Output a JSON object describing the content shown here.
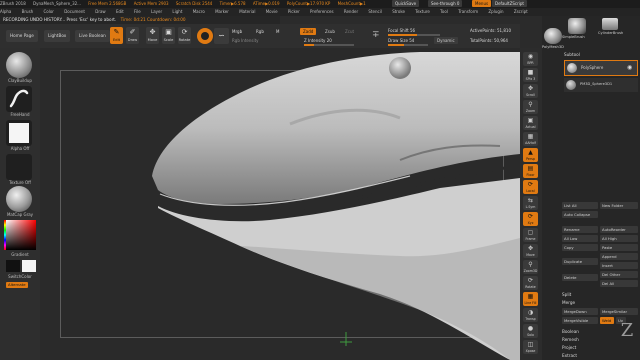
{
  "titlebar": {
    "app": "ZBrush 2018",
    "doc": "DynaMesh_Sphere_32...",
    "free_mem": "Free Mem 2.568GB",
    "active_mem": "Active Mem 2903",
    "scratch": "Scratch Disk 2544",
    "timer": "Timer▶6.578",
    "atime": "ATime▶0.019",
    "polycount": "PolyCount▶17.970 KP",
    "meshcount": "MeshCount▶1",
    "quicksave": "QuickSave",
    "seethrough": "See-through 0",
    "menus": "Menus",
    "default_script": "DefaultZScript"
  },
  "menubar": {
    "items": [
      "Alpha",
      "Brush",
      "Color",
      "Document",
      "Draw",
      "Edit",
      "File",
      "Layer",
      "Light",
      "Macro",
      "Marker",
      "Material",
      "Movie",
      "Picker",
      "Preferences",
      "Render",
      "Stencil",
      "Stroke",
      "Texture",
      "Tool",
      "Transform",
      "Zplugin",
      "Zscript"
    ]
  },
  "notice": {
    "text": "RECORDING UNDO HISTORY... Press 'Esc' key to abort.",
    "timer": "Time: 0d:21 Countdown: 0d:00"
  },
  "toolbar": {
    "home_page": "Home Page",
    "lightbox": "LightBox",
    "live_boolean": "Live Boolean",
    "edit": "Edit",
    "draw": "Draw",
    "move": "Move",
    "scale": "Scale",
    "rotate": "Rotate",
    "mrgb": "Mrgb",
    "rgb": "Rgb",
    "m": "M",
    "rgb_intensity": "Rgb Intensity",
    "zadd": "Zadd",
    "zsub": "Zsub",
    "zcut": "Zcut",
    "z_intensity": "Z Intensity 20",
    "focal_shift": "Focal Shift 56",
    "draw_size": "Draw Size 54",
    "dynamic": "Dynamic",
    "active_points": "ActivePoints: 51,810",
    "total_points": "TotalPoints: 50,964",
    "focal_shift_level": 0.55,
    "draw_size_level": 0.4,
    "z_intensity_level": 0.2
  },
  "leftshelf": {
    "brush": "ClayBuildup",
    "stroke": "FreeHand",
    "alpha": "Alpha Off",
    "texture": "Texture Off",
    "material": "MatCap Gray",
    "gradient": "Gradient",
    "switch_color": "SwitchColor",
    "alternate": "Alternate"
  },
  "rightstrip": {
    "items": [
      "BPR",
      "SPix 3",
      "Scroll",
      "Zoom",
      "Actual",
      "AAHalf",
      "Persp",
      "Floor",
      "Local",
      "L.Sym",
      "Xyz",
      "Frame",
      "Move",
      "Zoom3D",
      "Rotate",
      "Line Fill",
      "Transp",
      "Solo",
      "Xpose"
    ]
  },
  "tray": {
    "top_buttons": [
      "SimpleBrush",
      "PolyMesh3D",
      "CylinderBrush"
    ],
    "subtool_title": "Subtool",
    "subtool_name": "PolySphere",
    "subtool_sub": "PM3D_Sphere3D1",
    "list_all": "List All",
    "new_folder": "New Folder",
    "auto_collapse": "Auto Collapse",
    "rename": "Rename",
    "autoreorder": "AutoReorder",
    "all_low": "All Low",
    "all_high": "All High",
    "copy": "Copy",
    "paste": "Paste",
    "append": "Append",
    "duplicate": "Duplicate",
    "insert": "Insert",
    "del_other": "Del Other",
    "delete": "Delete",
    "del_all": "Del All",
    "split": "Split",
    "merge": "Merge",
    "merge_down": "MergeDown",
    "merge_similar": "MergeSimilar",
    "merge_visible": "MergeVisible",
    "weld": "Weld",
    "uv": "Uv",
    "boolean": "Boolean",
    "remesh": "Remesh",
    "project": "Project",
    "extract": "Extract"
  },
  "colors": {
    "accent": "#e07a12",
    "background": "#2a2a2a",
    "panel": "#2f2f2f"
  }
}
